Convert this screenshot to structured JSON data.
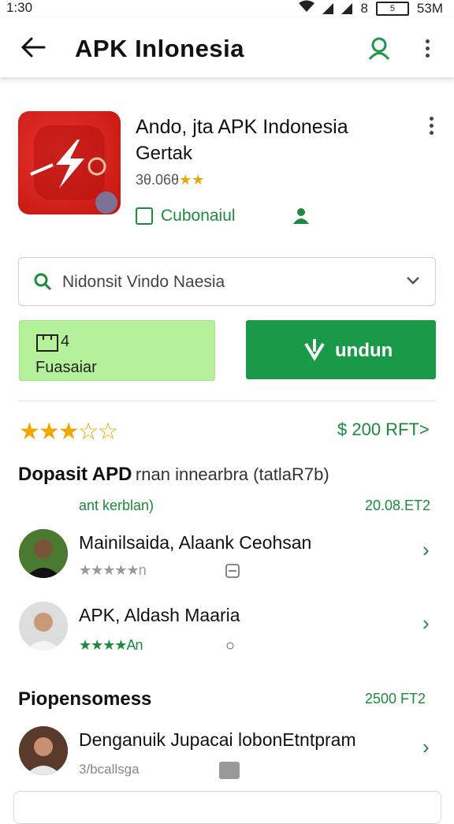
{
  "status_bar": {
    "time": "1:30",
    "right_text": "8",
    "battery": "5",
    "storage": "53M"
  },
  "app_bar": {
    "title": "APK Inlonesia"
  },
  "app": {
    "name": "Ando, jta APK Indonesia",
    "developer": "Gertak",
    "rating_text": "3θ.06θ",
    "stars": "★★",
    "category": "Cubonaiul"
  },
  "search": {
    "value": "Nidonsit Vindo Naesia"
  },
  "buttons": {
    "left_count": "4",
    "left_label": "Fuasaiar",
    "install_label": "undun"
  },
  "rating_row": {
    "stars": "★★★☆☆",
    "price": "$ 200 RFT>"
  },
  "section1": {
    "title": "Dopasit APD",
    "subtitle": "rnan innearbra (tatlaR7b)",
    "tag": "ant kerblan)",
    "tag_value": "20.08.ET2",
    "items": [
      {
        "name": "Mainilsaida, Alaank Ceohsan",
        "stars": "★★★★★",
        "meta": "n"
      },
      {
        "name": "APK, Aldash Maaria",
        "stars": "★★★★",
        "meta": "An"
      }
    ]
  },
  "section2": {
    "title": "Piopensomess",
    "value": "2500 FT2",
    "items": [
      {
        "name": "Denganuik Jupacai lobonEtntpram",
        "meta": "3/bcallsga"
      }
    ]
  },
  "colors": {
    "accent": "#1a9a48",
    "install_bg": "#1a9a48",
    "light_btn": "#b4f19a",
    "icon_red": "#d8231c"
  },
  "icons": [
    "back-arrow-icon",
    "account-icon",
    "more-vert-icon",
    "search-icon",
    "chevron-down-icon",
    "install-icon",
    "chevron-right-icon"
  ]
}
